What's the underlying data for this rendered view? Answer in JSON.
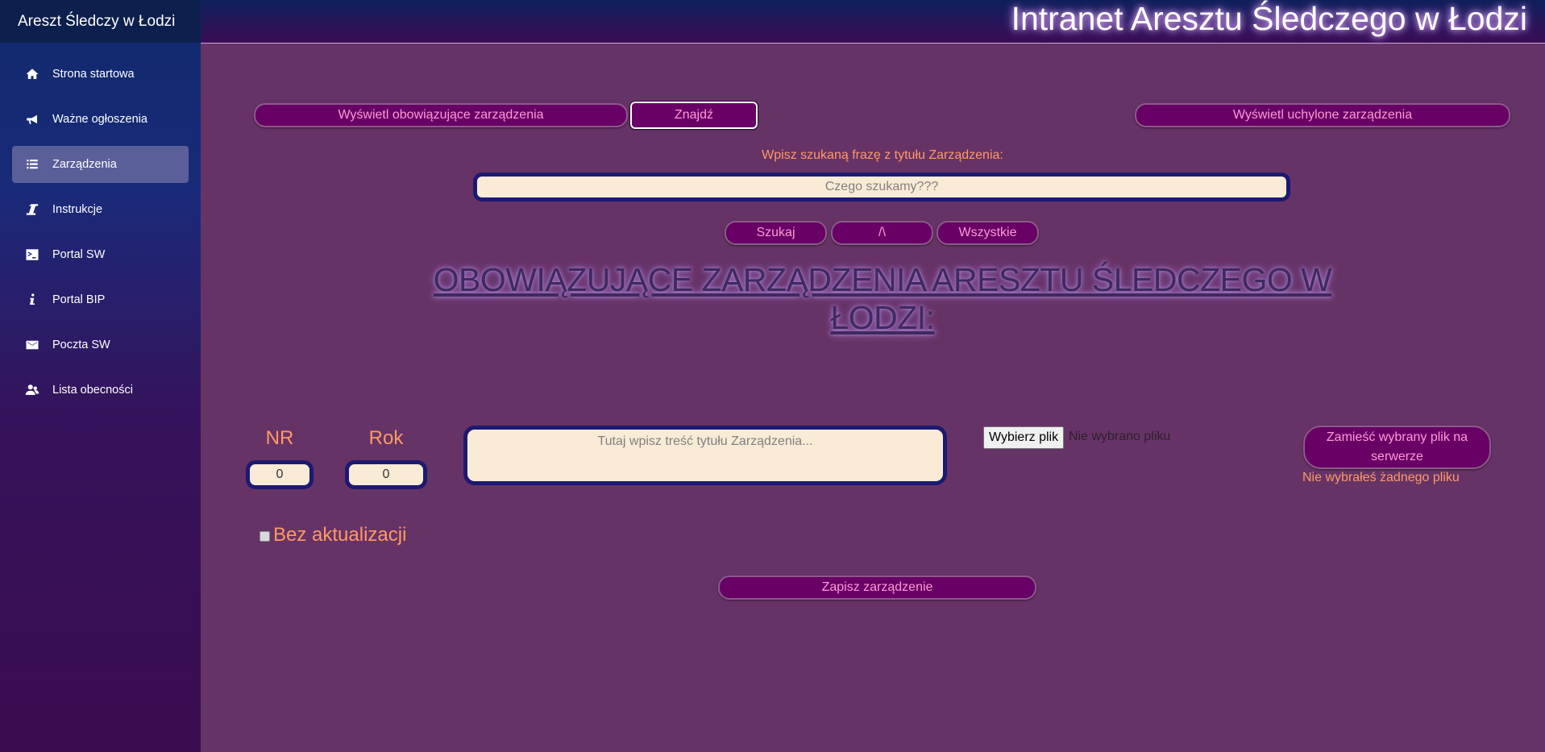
{
  "sidebar": {
    "brand": "Areszt Śledczy w Łodzi",
    "items": [
      {
        "label": "Strona startowa",
        "icon": "home-icon"
      },
      {
        "label": "Ważne ogłoszenia",
        "icon": "megaphone-icon"
      },
      {
        "label": "Zarządzenia",
        "icon": "list-icon",
        "active": true
      },
      {
        "label": "Instrukcje",
        "icon": "italic-icon"
      },
      {
        "label": "Portal SW",
        "icon": "terminal-icon"
      },
      {
        "label": "Portal BIP",
        "icon": "info-icon"
      },
      {
        "label": "Poczta SW",
        "icon": "envelope-icon"
      },
      {
        "label": "Lista obecności",
        "icon": "users-icon"
      }
    ]
  },
  "header": {
    "title": "Intranet Aresztu Śledczego w Łodzi"
  },
  "toolbar": {
    "show_current": "Wyświetl obowiązujące zarządzenia",
    "find": "Znajdź",
    "show_repealed": "Wyświetl uchylone zarządzenia"
  },
  "search": {
    "label": "Wpisz szukaną frazę z tytułu Zarządzenia:",
    "placeholder": "Czego szukamy???",
    "search_button": "Szukaj",
    "sort_button": "/\\",
    "all_button": "Wszystkie"
  },
  "main": {
    "heading": "OBOWIĄZUJĄCE ZARZĄDZENIA ARESZTU ŚLEDCZEGO W ŁODZI:"
  },
  "form": {
    "nr_label": "NR",
    "nr_value": "0",
    "year_label": "Rok",
    "year_value": "0",
    "title_placeholder": "Tutaj wpisz treść tytułu Zarządzenia...",
    "file_button": "Wybierz plik",
    "file_status": "Nie wybrano pliku",
    "upload_button": "Zamieść wybrany plik na serwerze",
    "upload_status": "Nie wybrałeś żadnego pliku",
    "no_update_label": "Bez aktualizacji",
    "save_button": "Zapisz zarządzenie"
  },
  "colors": {
    "background": "#663366",
    "button": "#680066",
    "button_text": "#ff9ad6",
    "label": "#ff9966",
    "field": "#faebd7",
    "field_border": "#1c1a70"
  }
}
